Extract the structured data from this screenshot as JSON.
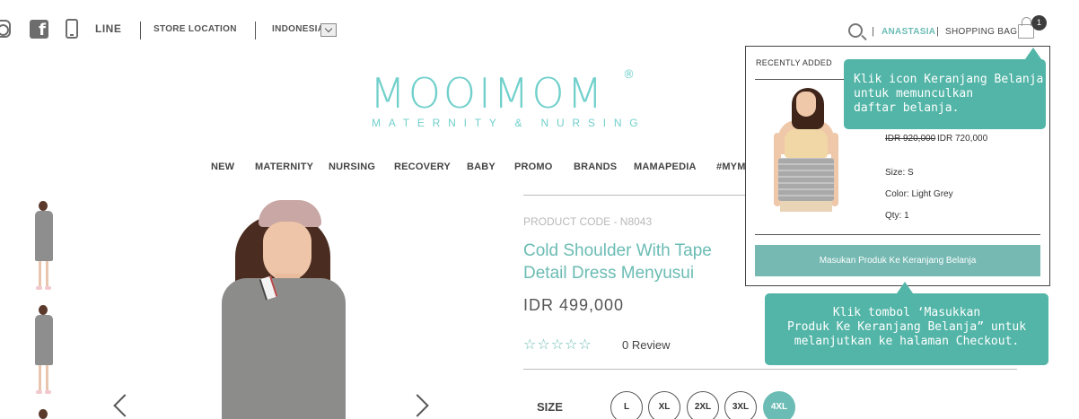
{
  "header": {
    "social": {
      "line_label": "LINE"
    },
    "store_location": "STORE LOCATION",
    "country": "INDONESIA",
    "account_name": "ANASTASIA",
    "separator": "|",
    "shopping_bag": "SHOPPING BAG",
    "bag_count": "1"
  },
  "logo": {
    "name": "MOOIMOM",
    "registered": "®",
    "tagline": "MATERNITY & NURSING"
  },
  "nav": {
    "items": [
      "NEW",
      "MATERNITY",
      "NURSING",
      "RECOVERY",
      "BABY",
      "PROMO",
      "BRANDS",
      "MAMAPEDIA",
      "#MYM"
    ]
  },
  "product": {
    "code": "PRODUCT CODE - N8043",
    "title": "Cold Shoulder With Tape Detail Dress Menyusui",
    "price": "IDR 499,000",
    "stars": "☆☆☆☆☆",
    "review": "0 Review",
    "size_label": "SIZE",
    "sizes": [
      "L",
      "XL",
      "2XL",
      "3XL",
      "4XL"
    ],
    "selected_size": "4XL"
  },
  "minicart": {
    "heading": "RECENTLY ADDED",
    "old_price": "IDR 920,000",
    "new_price": "IDR 720,000",
    "size": "Size: S",
    "color": "Color: Light Grey",
    "qty": "Qty: 1",
    "button": "Masukan Produk Ke Keranjang Belanja"
  },
  "tooltips": {
    "bag_tip": [
      "Klik icon Keranjang Belanja",
      "untuk memunculkan",
      "daftar belanja."
    ],
    "button_tip": [
      "Klik tombol ‘Masukkan",
      "Produk Ke Keranjang Belanja” untuk",
      "melanjutkan ke halaman Checkout."
    ]
  },
  "colors": {
    "accent": "#6bbcb4",
    "tooltip": "#52b5a7",
    "button": "#75b9b2"
  }
}
